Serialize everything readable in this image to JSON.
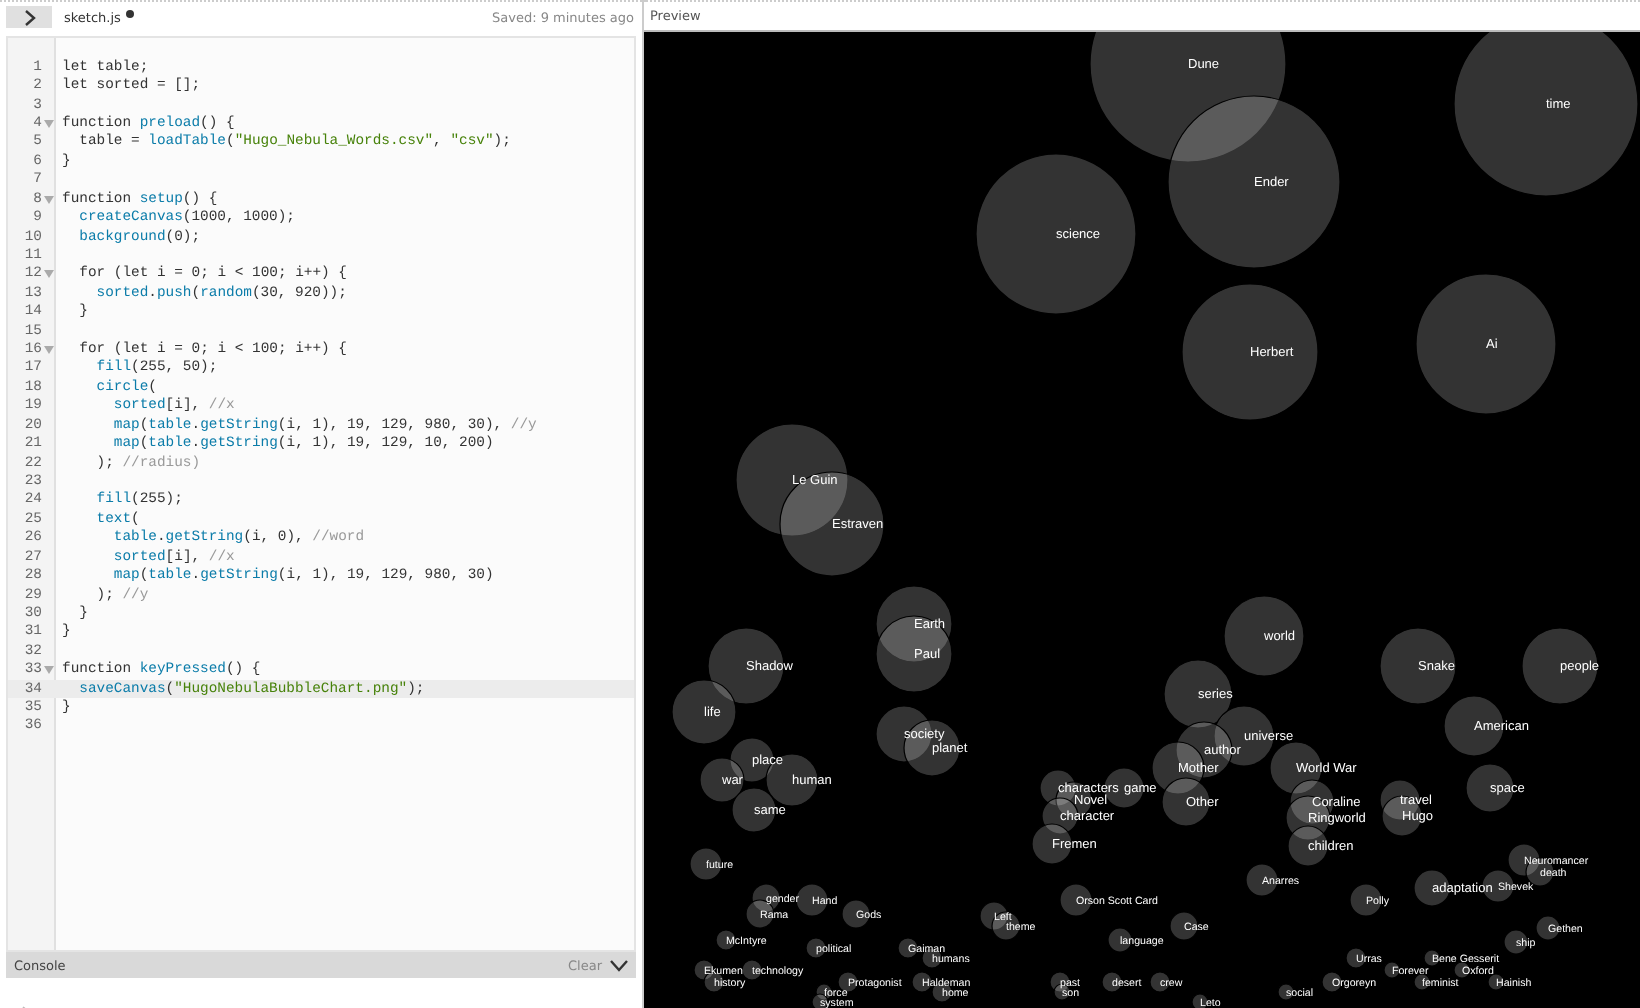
{
  "editor": {
    "tab": {
      "name": "sketch.js",
      "unsaved": true
    },
    "save_status": "Saved: 9 minutes ago",
    "lines": [
      {
        "number": "1",
        "foldable": false,
        "current": false,
        "code": "let table;"
      },
      {
        "number": "2",
        "foldable": false,
        "current": false,
        "code": "let sorted = [];"
      },
      {
        "number": "3",
        "foldable": false,
        "current": false
      },
      {
        "number": "4",
        "foldable": true,
        "current": false,
        "code": "function preload() {"
      },
      {
        "number": "5",
        "foldable": false,
        "current": false,
        "code": "  table = loadTable(\"Hugo_Nebula_Words.csv\", \"csv\");"
      },
      {
        "number": "6",
        "foldable": false,
        "current": false,
        "code": "}"
      },
      {
        "number": "7",
        "foldable": false,
        "current": false
      },
      {
        "number": "8",
        "foldable": true,
        "current": false,
        "code": "function setup() {"
      },
      {
        "number": "9",
        "foldable": false,
        "current": false,
        "code": "  createCanvas(1000, 1000);"
      },
      {
        "number": "10",
        "foldable": false,
        "current": false,
        "code": "  background(0);"
      },
      {
        "number": "11",
        "foldable": false,
        "current": false
      },
      {
        "number": "12",
        "foldable": true,
        "current": false,
        "code": "  for (let i = 0; i < 100; i++) {"
      },
      {
        "number": "13",
        "foldable": false,
        "current": false,
        "code": "    sorted.push(random(30, 920));"
      },
      {
        "number": "14",
        "foldable": false,
        "current": false,
        "code": "  }"
      },
      {
        "number": "15",
        "foldable": false,
        "current": false
      },
      {
        "number": "16",
        "foldable": true,
        "current": false,
        "code": "  for (let i = 0; i < 100; i++) {"
      },
      {
        "number": "17",
        "foldable": false,
        "current": false,
        "code": "    fill(255, 50);"
      },
      {
        "number": "18",
        "foldable": false,
        "current": false,
        "code": "    circle("
      },
      {
        "number": "19",
        "foldable": false,
        "current": false,
        "code": "      sorted[i], //x"
      },
      {
        "number": "20",
        "foldable": false,
        "current": false,
        "code": "      map(table.getString(i, 1), 19, 129, 980, 30), //y"
      },
      {
        "number": "21",
        "foldable": false,
        "current": false,
        "code": "      map(table.getString(i, 1), 19, 129, 10, 200)"
      },
      {
        "number": "22",
        "foldable": false,
        "current": false,
        "code": "    ); //radius)"
      },
      {
        "number": "23",
        "foldable": false,
        "current": false
      },
      {
        "number": "24",
        "foldable": false,
        "current": false,
        "code": "    fill(255);"
      },
      {
        "number": "25",
        "foldable": false,
        "current": false,
        "code": "    text("
      },
      {
        "number": "26",
        "foldable": false,
        "current": false,
        "code": "      table.getString(i, 0), //word"
      },
      {
        "number": "27",
        "foldable": false,
        "current": false,
        "code": "      sorted[i], //x"
      },
      {
        "number": "28",
        "foldable": false,
        "current": false,
        "code": "      map(table.getString(i, 1), 19, 129, 980, 30)"
      },
      {
        "number": "29",
        "foldable": false,
        "current": false,
        "code": "    ); //y"
      },
      {
        "number": "30",
        "foldable": false,
        "current": false,
        "code": "  }"
      },
      {
        "number": "31",
        "foldable": false,
        "current": false,
        "code": "}"
      },
      {
        "number": "32",
        "foldable": false,
        "current": false
      },
      {
        "number": "33",
        "foldable": true,
        "current": false,
        "code": "function keyPressed() {"
      },
      {
        "number": "34",
        "foldable": false,
        "current": true,
        "code": "  saveCanvas(\"HugoNebulaBubbleChart.png\");"
      },
      {
        "number": "35",
        "foldable": false,
        "current": false,
        "code": "}"
      },
      {
        "number": "36",
        "foldable": false,
        "current": false
      }
    ]
  },
  "console": {
    "title": "Console",
    "clear_label": "Clear"
  },
  "preview": {
    "title": "Preview",
    "bubbles": [
      {
        "word": "Dune"
      },
      {
        "word": "time"
      },
      {
        "word": "Ender"
      },
      {
        "word": "science"
      },
      {
        "word": "Ai"
      },
      {
        "word": "Herbert"
      },
      {
        "word": "Le Guin"
      },
      {
        "word": "Estraven"
      },
      {
        "word": "Earth"
      },
      {
        "word": "world"
      },
      {
        "word": "Paul"
      },
      {
        "word": "Shadow"
      },
      {
        "word": "Snake"
      },
      {
        "word": "people"
      },
      {
        "word": "series"
      },
      {
        "word": "life"
      },
      {
        "word": "American"
      },
      {
        "word": "society"
      },
      {
        "word": "universe"
      },
      {
        "word": "planet"
      },
      {
        "word": "author"
      },
      {
        "word": "place"
      },
      {
        "word": "Mother"
      },
      {
        "word": "World War"
      },
      {
        "word": "war"
      },
      {
        "word": "human"
      },
      {
        "word": "characters"
      },
      {
        "word": "game"
      },
      {
        "word": "space"
      },
      {
        "word": "Novel"
      },
      {
        "word": "Other"
      },
      {
        "word": "Coraline"
      },
      {
        "word": "travel"
      },
      {
        "word": "same"
      },
      {
        "word": "character"
      },
      {
        "word": "Ringworld"
      },
      {
        "word": "Hugo"
      },
      {
        "word": "Fremen"
      },
      {
        "word": "children"
      },
      {
        "word": "future"
      },
      {
        "word": "Neuromancer"
      },
      {
        "word": "death"
      },
      {
        "word": "Anarres"
      },
      {
        "word": "adaptation"
      },
      {
        "word": "Shevek"
      },
      {
        "word": "gender"
      },
      {
        "word": "Hand"
      },
      {
        "word": "Orson Scott Card"
      },
      {
        "word": "Polly"
      },
      {
        "word": "Rama"
      },
      {
        "word": "Gods"
      },
      {
        "word": "Left"
      },
      {
        "word": "theme"
      },
      {
        "word": "Case"
      },
      {
        "word": "Gethen"
      },
      {
        "word": "McIntyre"
      },
      {
        "word": "language"
      },
      {
        "word": "ship"
      },
      {
        "word": "political"
      },
      {
        "word": "Gaiman"
      },
      {
        "word": "humans"
      },
      {
        "word": "Urras"
      },
      {
        "word": "Bene Gesserit"
      },
      {
        "word": "Ekumen"
      },
      {
        "word": "technology"
      },
      {
        "word": "Forever"
      },
      {
        "word": "Oxford"
      },
      {
        "word": "history"
      },
      {
        "word": "Protagonist"
      },
      {
        "word": "Haldeman"
      },
      {
        "word": "past"
      },
      {
        "word": "desert"
      },
      {
        "word": "crew"
      },
      {
        "word": "Orgoreyn"
      },
      {
        "word": "feminist"
      },
      {
        "word": "Hainish"
      },
      {
        "word": "force"
      },
      {
        "word": "home"
      },
      {
        "word": "son"
      },
      {
        "word": "social"
      },
      {
        "word": "system"
      },
      {
        "word": "Leto"
      }
    ]
  }
}
